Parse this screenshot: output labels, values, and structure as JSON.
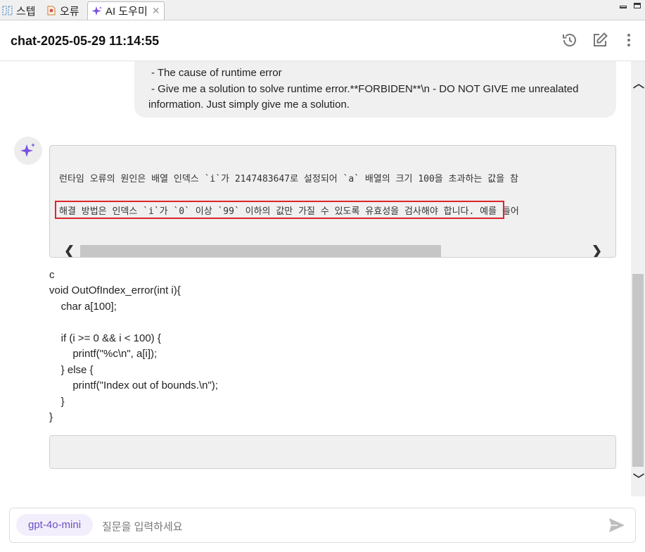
{
  "tabs": [
    {
      "label": "스텝",
      "icon": "steps-icon"
    },
    {
      "label": "오류",
      "icon": "error-icon"
    },
    {
      "label": "AI 도우미",
      "icon": "sparkle-icon",
      "active": true
    }
  ],
  "header": {
    "title": "chat-2025-05-29 11:14:55",
    "icons": [
      "history-icon",
      "edit-icon",
      "more-vert-icon"
    ]
  },
  "chat": {
    "user_lines": [
      "- The cause of runtime error",
      "- Give me a solution to solve runtime error.**FORBIDEN**\\n - DO NOT GIVE me unrealated",
      "information. Just simply give me a solution."
    ],
    "answer_lines": [
      "런타임 오류의 원인은 배열 인덱스 `i`가 2147483647로 설정되어 `a` 배열의 크기 100을 초과하는 값을 참",
      "해결 방법은 인덱스 `i`가 `0` 이상 `99` 이하의 값만 가질 수 있도록 유효성을 검사해야 합니다. 예를 들어"
    ],
    "code_lang": "c",
    "code": "void OutOfIndex_error(int i){\n    char a[100];\n\n    if (i >= 0 && i < 100) {\n        printf(\"%c\\n\", a[i]);\n    } else {\n        printf(\"Index out of bounds.\\n\");\n    }\n}"
  },
  "input": {
    "model": "gpt-4o-mini",
    "placeholder": "질문을 입력하세요"
  },
  "colors": {
    "accent": "#6b4fc8",
    "highlight_border": "#e0242b",
    "bubble_bg": "#f0f0f0"
  }
}
